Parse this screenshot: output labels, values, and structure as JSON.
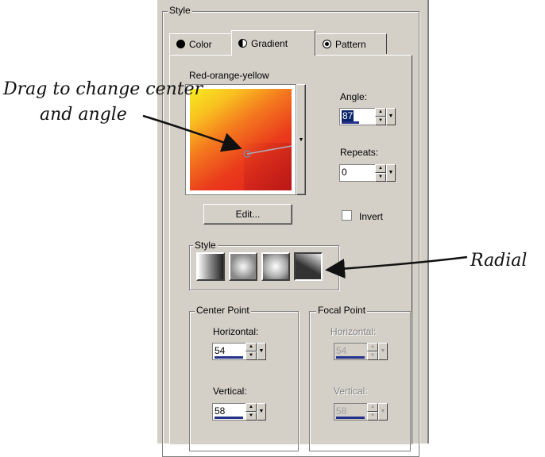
{
  "style_group_label": "Style",
  "tabs": [
    {
      "label": "Color",
      "icon": "circle-icon"
    },
    {
      "label": "Gradient",
      "icon": "half-circle-icon"
    },
    {
      "label": "Pattern",
      "icon": "globe-icon"
    }
  ],
  "active_tab": "Gradient",
  "gradient_name": "Red-orange-yellow",
  "angle": {
    "label": "Angle:",
    "value": "87"
  },
  "repeats": {
    "label": "Repeats:",
    "value": "0"
  },
  "edit_button": "Edit...",
  "invert": {
    "label": "Invert",
    "checked": false
  },
  "style_subgroup_label": "Style",
  "style_types": [
    "linear-gradient-icon",
    "rectangular-gradient-icon",
    "sunburst-gradient-icon",
    "radial-gradient-icon"
  ],
  "center_point": {
    "label": "Center Point",
    "horizontal_label": "Horizontal:",
    "horizontal_value": "54",
    "vertical_label": "Vertical:",
    "vertical_value": "58"
  },
  "focal_point": {
    "label": "Focal Point",
    "horizontal_label": "Horizontal:",
    "horizontal_value": "54",
    "vertical_label": "Vertical:",
    "vertical_value": "58"
  },
  "annotations": {
    "drag_line1": "Drag to change center",
    "drag_line2": "and angle",
    "radial": "Radial"
  },
  "colors": {
    "panel": "#d4d0c8",
    "gradient_red": "#e8221c",
    "gradient_orange": "#f47a1e",
    "gradient_yellow": "#f7e818",
    "selection": "#0a246a"
  }
}
